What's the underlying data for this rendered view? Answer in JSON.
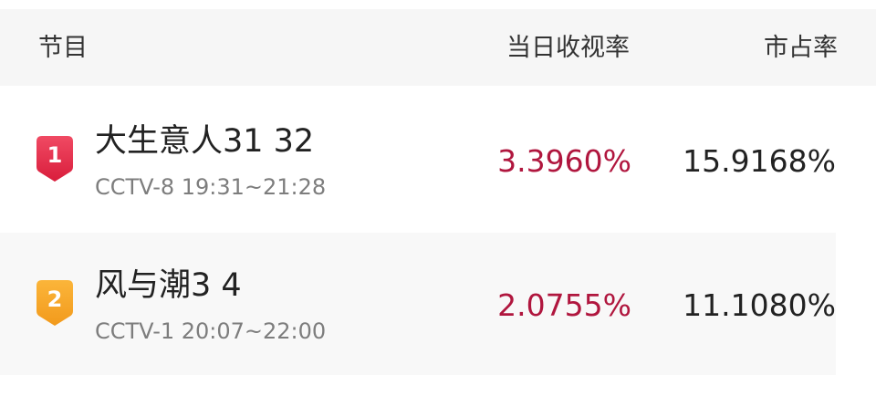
{
  "header": {
    "program": "节目",
    "daily_rating": "当日收视率",
    "market_share": "市占率"
  },
  "rows": [
    {
      "rank": "1",
      "badge_color": "#e8344f",
      "title": "大生意人31 32",
      "channel_time": "CCTV-8 19:31~21:28",
      "rating": "3.3960%",
      "share": "15.9168%"
    },
    {
      "rank": "2",
      "badge_color": "#f6a623",
      "title": "风与潮3 4",
      "channel_time": "CCTV-1 20:07~22:00",
      "rating": "2.0755%",
      "share": "11.1080%"
    }
  ],
  "colors": {
    "rating_text": "#b0163e",
    "header_bg": "#f6f6f6"
  }
}
